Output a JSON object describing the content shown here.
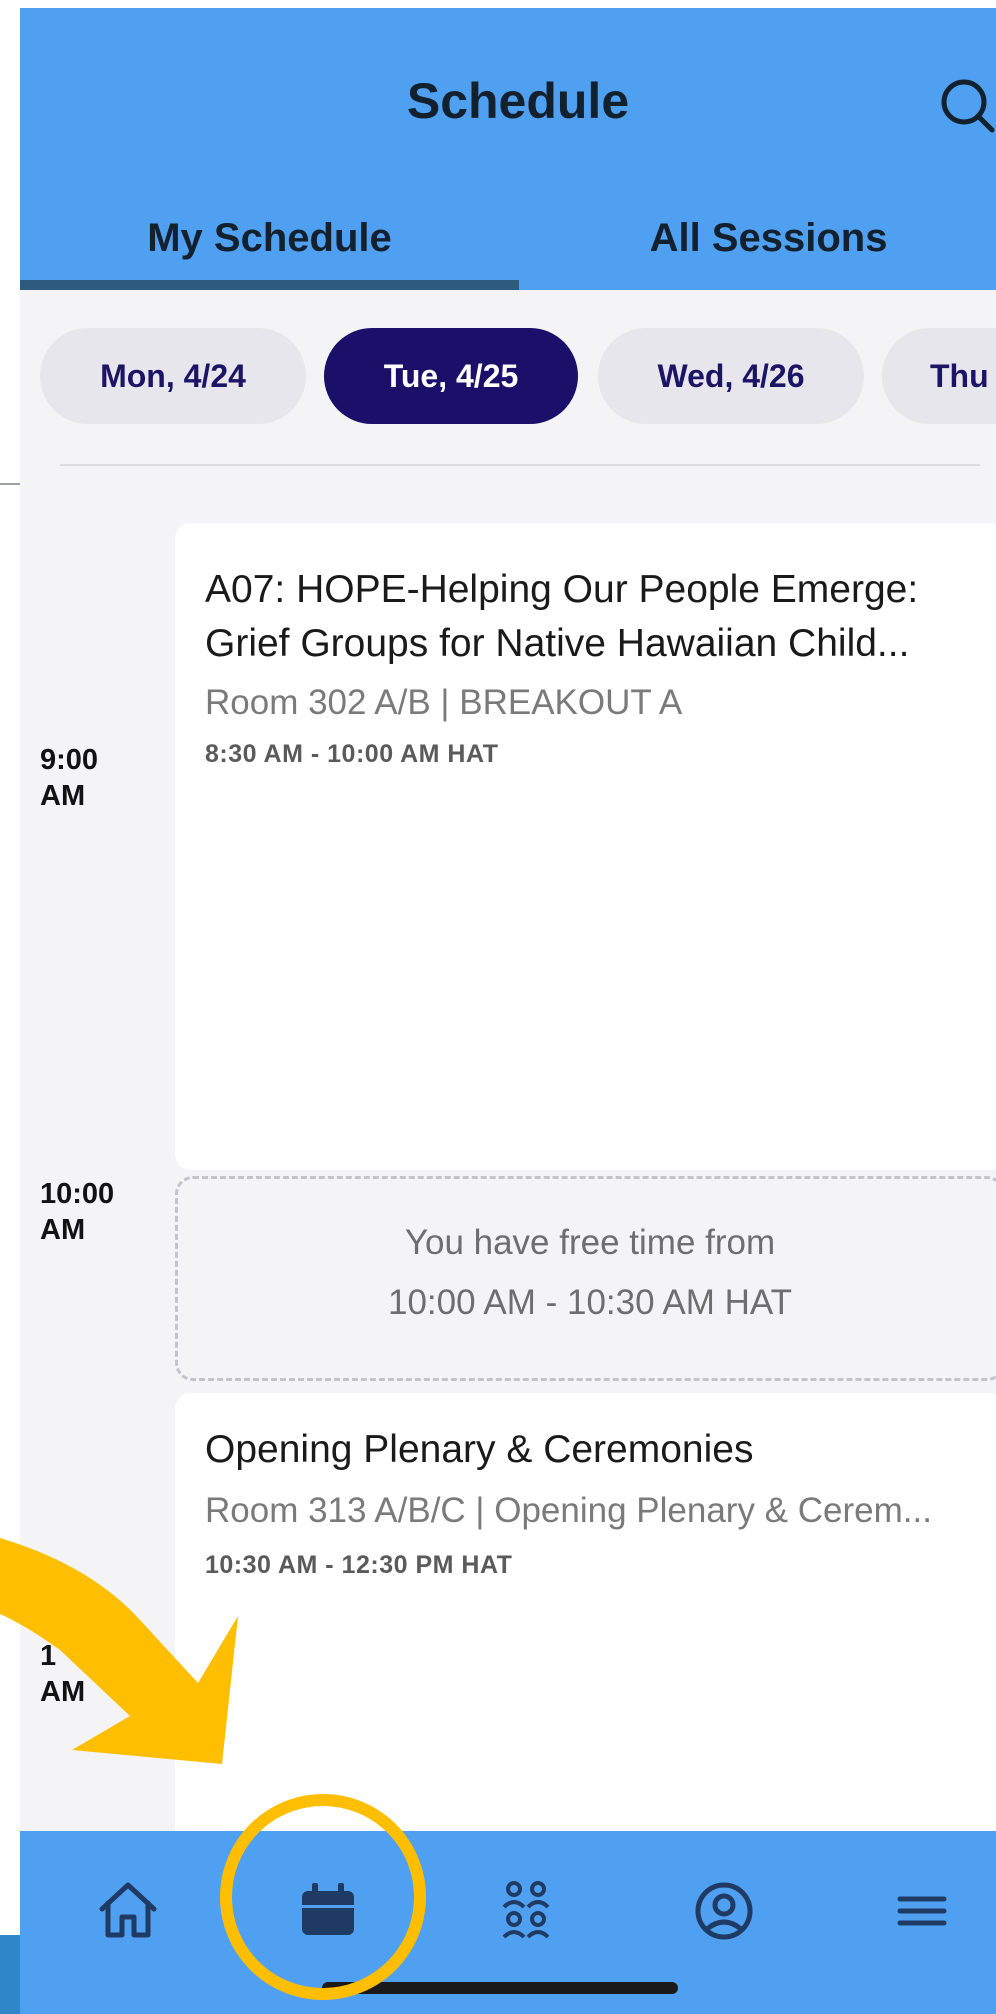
{
  "header": {
    "title": "Schedule",
    "search_icon": "search-icon"
  },
  "tabs": [
    {
      "label": "My Schedule",
      "selected": true
    },
    {
      "label": "All Sessions",
      "selected": false
    }
  ],
  "dates": [
    {
      "label": "Mon, 4/24",
      "selected": false
    },
    {
      "label": "Tue, 4/25",
      "selected": true
    },
    {
      "label": "Wed, 4/26",
      "selected": false
    },
    {
      "label": "Thu",
      "selected": false
    }
  ],
  "time_labels": [
    {
      "hour": "9:00",
      "period": "AM"
    },
    {
      "hour": "10:00",
      "period": "AM"
    },
    {
      "hour": "1",
      "period": "AM"
    }
  ],
  "sessions": [
    {
      "title_line1": "A07: HOPE-Helping Our People Emerge:",
      "title_line2": "Grief Groups for Native Hawaiian Child...",
      "location": "Room 302 A/B | BREAKOUT A",
      "time": "8:30 AM - 10:00 AM HAT"
    },
    {
      "title": "Opening Plenary & Ceremonies",
      "location": "Room 313 A/B/C | Opening Plenary & Cerem...",
      "time": "10:30 AM - 12:30 PM HAT"
    }
  ],
  "free_time": {
    "line1": "You have free time from",
    "line2": "10:00 AM - 10:30 AM HAT"
  },
  "bottom_nav": [
    {
      "icon": "home-icon",
      "selected": false
    },
    {
      "icon": "calendar-icon",
      "selected": true
    },
    {
      "icon": "people-icon",
      "selected": false
    },
    {
      "icon": "profile-icon",
      "selected": false
    },
    {
      "icon": "menu-icon",
      "selected": false
    }
  ],
  "colors": {
    "header_bg": "#4fa0f0",
    "active_chip": "#1b0f6a",
    "annotation_yellow": "#ffbf00"
  }
}
